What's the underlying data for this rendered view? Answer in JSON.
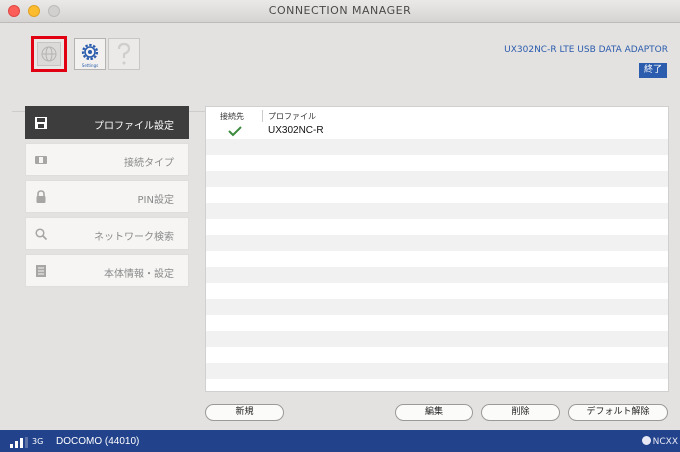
{
  "window": {
    "title": "CONNECTION MANAGER"
  },
  "toolbar": {
    "home_icon": "globe-home-icon",
    "settings_icon": "gear-icon",
    "settings_caption": "Settings",
    "help_icon": "question-icon",
    "model": "UX302NC-R LTE USB DATA ADAPTOR",
    "exit_label": "終了",
    "highlight_color": "#e10012",
    "accent_color": "#2b5cae"
  },
  "sidebar": {
    "items": [
      {
        "label": "プロファイル設定",
        "icon": "save-icon",
        "active": true
      },
      {
        "label": "接続タイプ",
        "icon": "device-icon",
        "active": false
      },
      {
        "label": "PIN設定",
        "icon": "lock-icon",
        "active": false
      },
      {
        "label": "ネットワーク検索",
        "icon": "search-icon",
        "active": false
      },
      {
        "label": "本体情報・設定",
        "icon": "info-list-icon",
        "active": false
      }
    ]
  },
  "profiles": {
    "columns": [
      "接続先",
      "プロファイル"
    ],
    "rows": [
      {
        "connected": true,
        "name": "UX302NC-R"
      }
    ]
  },
  "buttons": {
    "new": "新規",
    "edit": "編集",
    "delete": "削除",
    "default_clear": "デフォルト解除"
  },
  "status": {
    "signal_icon": "signal-bars-icon",
    "network": "3G",
    "carrier": "DOCOMO (44010)",
    "brand": "NCXX"
  }
}
